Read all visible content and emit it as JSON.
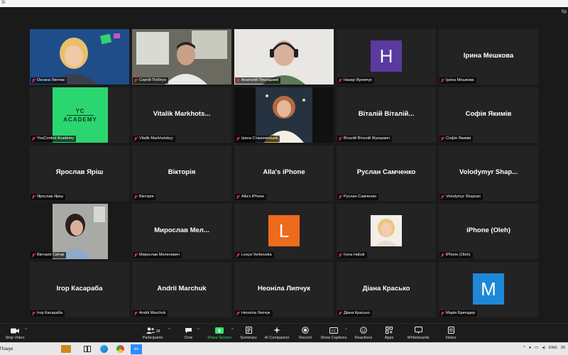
{
  "window": {
    "title_left": "Зі",
    "title_right": "Sp"
  },
  "tiles": [
    {
      "label": "Оксана Линчак",
      "kind": "video-woman-green"
    },
    {
      "label": "Сергій Побігун",
      "kind": "video-man-window"
    },
    {
      "label": "Анатолій Пясецький",
      "kind": "video-man-headset",
      "active": true
    },
    {
      "label": "Назар Яремчук",
      "kind": "avatar",
      "initial": "H",
      "color": "#5a3a9e"
    },
    {
      "label": "Ірина Мешкова",
      "kind": "name",
      "name": "Ірина Мешкова"
    },
    {
      "label": "YouControl Academy",
      "kind": "logo",
      "logo_line1": "YC",
      "logo_line2": "ACADEMY",
      "color": "#2bd670"
    },
    {
      "label": "Vitalik Markhotskyy",
      "kind": "name",
      "name": "Vitalik  Markhots..."
    },
    {
      "label": "Ірина Станкевтська",
      "kind": "video-woman-blonde"
    },
    {
      "label": "Віталій Віталій Жукаєвич",
      "kind": "name",
      "name": "Віталій Віталій..."
    },
    {
      "label": "Софія Якимів",
      "kind": "name",
      "name": "Софія Якимів"
    },
    {
      "label": "Ярослав Яріш",
      "kind": "name",
      "name": "Ярослав Яріш"
    },
    {
      "label": "Вікторія",
      "kind": "name",
      "name": "Вікторія"
    },
    {
      "label": "Alla's iPhone",
      "kind": "name",
      "name": "Alla's iPhone"
    },
    {
      "label": "Руслан Самченко",
      "kind": "name",
      "name": "Руслан Самченко"
    },
    {
      "label": "Volodymyr Shapran",
      "kind": "name",
      "name": "Volodymyr  Shap..."
    },
    {
      "label": "Вікторія Світак",
      "kind": "video-woman-dark"
    },
    {
      "label": "Мирослав Меленевич",
      "kind": "name",
      "name": "Мирослав  Мел..."
    },
    {
      "label": "Lesya Verbovska",
      "kind": "avatar",
      "initial": "L",
      "color": "#ee6a1c"
    },
    {
      "label": "Iryna Haliuk",
      "kind": "photo"
    },
    {
      "label": "iPhone (Oleh)",
      "kind": "name",
      "name": "iPhone (Oleh)"
    },
    {
      "label": "Ігор Касараба",
      "kind": "name",
      "name": "Ігор Касараба"
    },
    {
      "label": "Andrii Marchuk",
      "kind": "name",
      "name": "Andrii Marchuk"
    },
    {
      "label": "Неоніла Липчук",
      "kind": "name",
      "name": "Неоніла Липчук"
    },
    {
      "label": "Діана Красько",
      "kind": "name",
      "name": "Діана Красько"
    },
    {
      "label": "Марія Бригадер",
      "kind": "avatar",
      "initial": "M",
      "color": "#1e88d8"
    }
  ],
  "toolbar": {
    "stop_video": "Stop Video",
    "participants": "Participants",
    "participants_count": "28",
    "chat": "Chat",
    "share_screen": "Share Screen",
    "summary": "Summary",
    "ai_companion": "AI Companion",
    "record": "Record",
    "show_captions": "Show Captions",
    "reactions": "Reactions",
    "apps": "Apps",
    "whiteboards": "Whiteboards",
    "notes": "Notes",
    "share_color": "#3fdd72"
  },
  "taskbar": {
    "search": "Пошук",
    "zoom_icon_text": "zm",
    "lang": "ENG",
    "clock": "26"
  }
}
